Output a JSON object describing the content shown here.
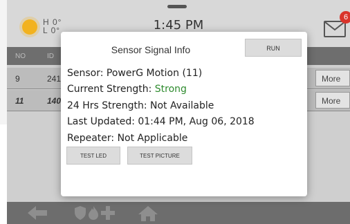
{
  "topbar": {
    "temp_high": "H 0°",
    "temp_low": "L 0°",
    "time": "1:45 PM",
    "mail_count": "6"
  },
  "list": {
    "headers": [
      "NO",
      "ID"
    ],
    "rows": [
      {
        "no": "9",
        "id": "241",
        "action": "More"
      },
      {
        "no": "11",
        "id": "140",
        "action": "More"
      }
    ]
  },
  "modal": {
    "title": "Sensor Signal Info",
    "run_label": "RUN",
    "sensor_line": "Sensor: PowerG Motion (11)",
    "current_label": "Current Strength:",
    "current_value": "Strong",
    "hrs24_line": "24 Hrs Strength: Not Available",
    "updated_line": "Last Updated: 01:44 PM, Aug 06, 2018",
    "repeater_line": "Repeater: Not Applicable",
    "test_led_label": "TEST LED",
    "test_picture_label": "TEST PICTURE"
  },
  "colors": {
    "strong": "#2e8b2e",
    "badge": "#d9342b",
    "sun": "#f2b21e"
  },
  "icons": [
    "sun-icon",
    "mail-icon",
    "back-arrow-icon",
    "shield-icon",
    "fire-icon",
    "medical-cross-icon",
    "home-icon"
  ]
}
